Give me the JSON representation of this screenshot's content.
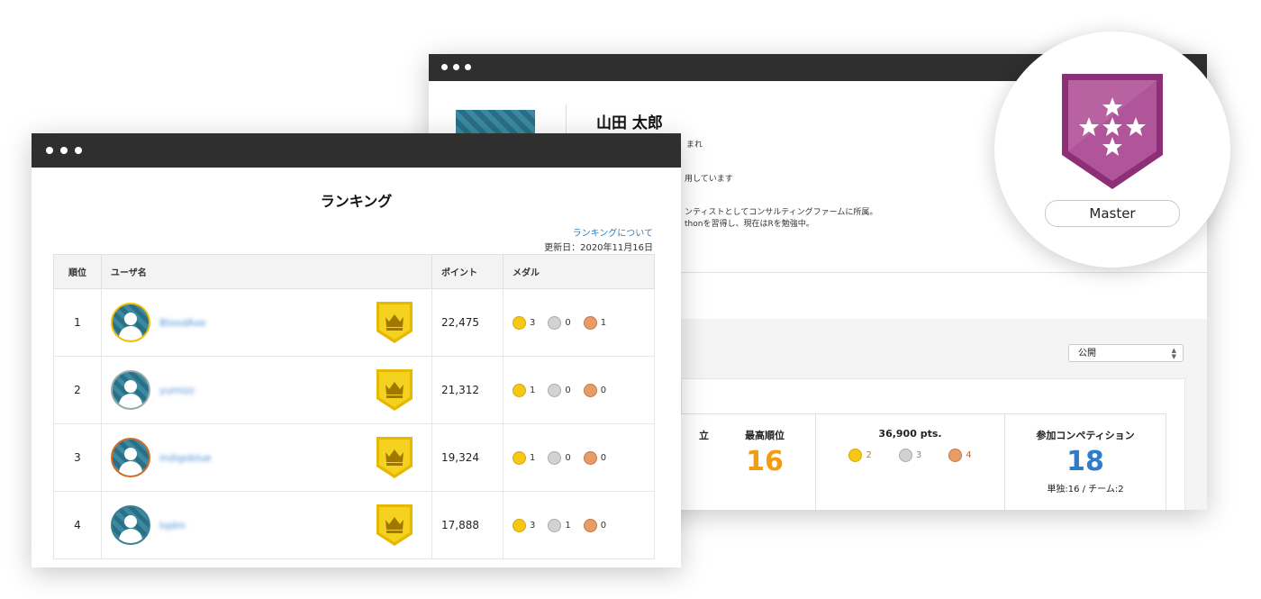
{
  "profile": {
    "name": "山田 太郎",
    "lines": [
      "まれ",
      "用しています",
      "ンティストとしてコンサルティングファームに所属。",
      "thonを習得し、現在はRを勉強中。"
    ],
    "visibility": "公開",
    "stats": {
      "partial_label": "立",
      "best_rank_label": "最高順位",
      "best_rank_value": "16",
      "points_label": "36,900 pts.",
      "medals": {
        "gold": "2",
        "silver": "3",
        "bronze": "4"
      },
      "competitions_label": "参加コンペティション",
      "competitions_value": "18",
      "competitions_breakdown": "単独:16 / チーム:2"
    }
  },
  "master_badge": {
    "label": "Master",
    "color": "#a8488f"
  },
  "ranking": {
    "title": "ランキング",
    "about_link": "ランキングについて",
    "updated": "更新日：2020年11月16日",
    "columns": [
      "順位",
      "ユーザ名",
      "ポイント",
      "メダル"
    ],
    "rows": [
      {
        "rank": "1",
        "user": "BloodAxe",
        "points": "22,475",
        "gold": "3",
        "silver": "0",
        "bronze": "1"
      },
      {
        "rank": "2",
        "user": "yumizz",
        "points": "21,312",
        "gold": "1",
        "silver": "0",
        "bronze": "0"
      },
      {
        "rank": "3",
        "user": "indigoblue",
        "points": "19,324",
        "gold": "1",
        "silver": "0",
        "bronze": "0"
      },
      {
        "rank": "4",
        "user": "tqdm",
        "points": "17,888",
        "gold": "3",
        "silver": "1",
        "bronze": "0"
      }
    ]
  },
  "colors": {
    "gold": "#f6c816",
    "silver": "#d2d2d2",
    "bronze": "#e89c66",
    "accent_orange": "#f39c12",
    "accent_blue": "#2f7dc9"
  }
}
